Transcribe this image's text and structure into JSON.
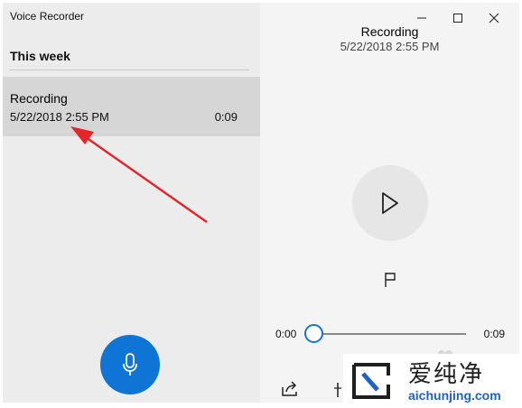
{
  "app": {
    "title": "Voice Recorder"
  },
  "list": {
    "group_header": "This week",
    "items": [
      {
        "title": "Recording",
        "date": "5/22/2018 2:55 PM",
        "duration": "0:09",
        "selected": true
      }
    ]
  },
  "player": {
    "title": "Recording",
    "date": "5/22/2018 2:55 PM",
    "time_current": "0:00",
    "time_total": "0:09",
    "progress": 0.0
  },
  "icons": {
    "record": "microphone-icon",
    "play": "play-icon",
    "marker": "flag-icon",
    "share": "share-icon",
    "trim": "trim-icon",
    "minimize": "minimize-icon",
    "maximize": "maximize-icon",
    "close": "close-icon"
  },
  "colors": {
    "accent": "#0e74d6",
    "annotation_arrow": "#e3262b",
    "selected_item": "#d6d6d6"
  },
  "watermark": {
    "text_cn": "爱纯净",
    "url": "aichunjing.com"
  }
}
